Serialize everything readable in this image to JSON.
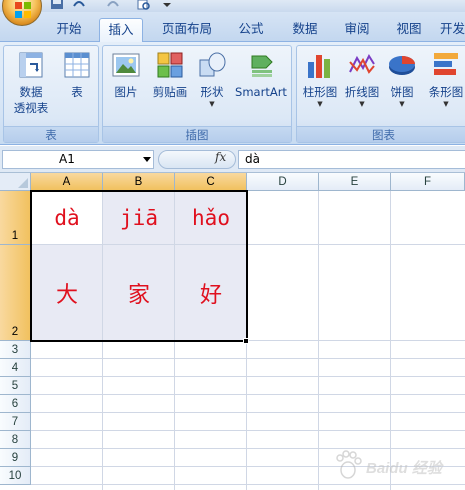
{
  "tabs": [
    {
      "label": "开始",
      "active": false
    },
    {
      "label": "插入",
      "active": true
    },
    {
      "label": "页面布局",
      "active": false
    },
    {
      "label": "公式",
      "active": false
    },
    {
      "label": "数据",
      "active": false
    },
    {
      "label": "审阅",
      "active": false
    },
    {
      "label": "视图",
      "active": false
    },
    {
      "label": "开发",
      "active": false
    }
  ],
  "ribbon": {
    "groups": {
      "table": {
        "label": "表",
        "pivot_line1": "数据",
        "pivot_line2": "透视表",
        "table_label": "表"
      },
      "illustrations": {
        "label": "插图",
        "picture": "图片",
        "clipart": "剪贴画",
        "shapes": "形状",
        "smartart": "SmartArt"
      },
      "charts": {
        "label": "图表",
        "column": "柱形图",
        "line": "折线图",
        "pie": "饼图",
        "bar": "条形图"
      }
    }
  },
  "formula_bar": {
    "name_box": "A1",
    "fx": "fx",
    "content": "dà"
  },
  "sheet": {
    "columns": [
      "A",
      "B",
      "C",
      "D",
      "E",
      "F"
    ],
    "selected_columns": [
      "A",
      "B",
      "C"
    ],
    "rows": [
      "1",
      "2",
      "3",
      "4",
      "5",
      "6",
      "7",
      "8",
      "9",
      "10"
    ],
    "selected_rows": [
      "1",
      "2"
    ],
    "row1": [
      "dà",
      "jiā",
      "hǎo"
    ],
    "row2": [
      "大",
      "家",
      "好"
    ],
    "text_color": "#e0101e",
    "shade_color": "#e8eaf4"
  },
  "watermark": {
    "icon": "baidu-paw-icon",
    "text": "Baidu 经验"
  }
}
